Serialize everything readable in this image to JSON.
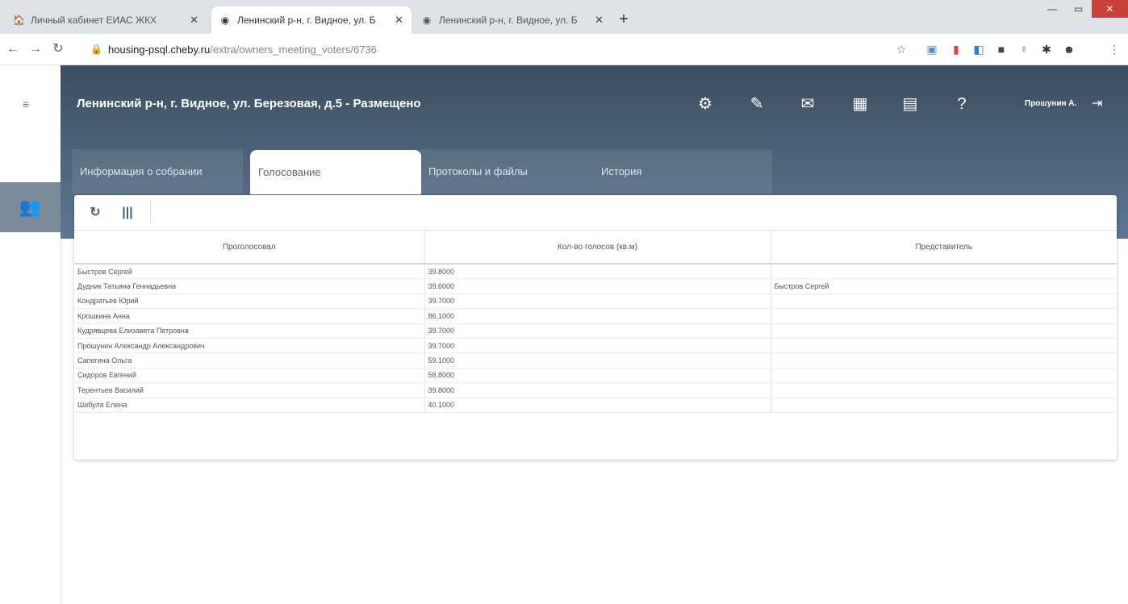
{
  "browser": {
    "tabs": [
      {
        "title": "Личный кабинет ЕИАС ЖКХ",
        "active": false
      },
      {
        "title": "Ленинский р-н, г. Видное, ул. Б",
        "active": true
      },
      {
        "title": "Ленинский р-н, г. Видное, ул. Б",
        "active": false
      }
    ],
    "new_tab": "+",
    "url_host": "housing-psql.cheby.ru",
    "url_path": "/extra/owners_meeting_voters/6736"
  },
  "app": {
    "title": "Ленинский р-н, г. Видное, ул. Березовая, д.5 - Размещено",
    "user": "Прошунин А.",
    "tabs": [
      {
        "label": "Информация о собрании",
        "active": false
      },
      {
        "label": "Голосование",
        "active": true
      },
      {
        "label": "Протоколы и файлы",
        "active": false
      },
      {
        "label": "История",
        "active": false
      }
    ],
    "header_icons": [
      "gear-icon",
      "document-edit-icon",
      "chat-icon",
      "calculator-icon",
      "report-icon",
      "help-icon"
    ]
  },
  "grid": {
    "columns": [
      "Проголосовал",
      "Кол-во голосов (кв.м)",
      "Представитель"
    ],
    "rows": [
      [
        "Быстров Сергей",
        "39.8000",
        ""
      ],
      [
        "Дудник Татьяна Геннадьевна",
        "39.6000",
        "Быстров Сергей"
      ],
      [
        "Кондратьев Юрий",
        "39.7000",
        ""
      ],
      [
        "Крошкина Анна",
        "86.1000",
        ""
      ],
      [
        "Кудрявцева Елизавета Петровна",
        "39.7000",
        ""
      ],
      [
        "Прошунин Александр Александрович",
        "39.7000",
        ""
      ],
      [
        "Сапегина Ольга",
        "59.1000",
        ""
      ],
      [
        "Сидоров Евгений",
        "58.8000",
        ""
      ],
      [
        "Терентьев Василий",
        "39.8000",
        ""
      ],
      [
        "Шибуля Елена",
        "40.1000",
        ""
      ]
    ]
  },
  "colors": {
    "header_dark": "#3b4d60",
    "header_light": "#5e7793",
    "rail_active": "#7b8a99"
  }
}
